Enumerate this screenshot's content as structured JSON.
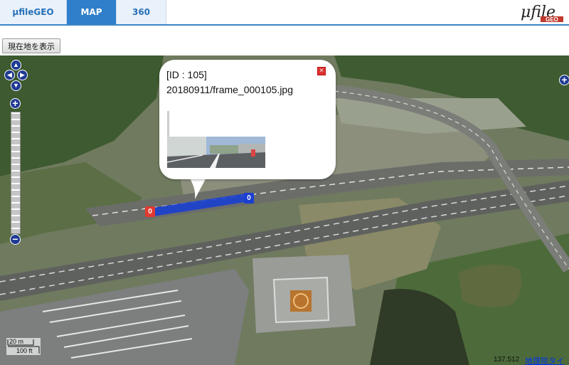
{
  "tabs": [
    {
      "label": "μfileGEO",
      "active": false
    },
    {
      "label": "MAP",
      "active": true
    },
    {
      "label": "360",
      "active": false
    }
  ],
  "logo": {
    "text": "μfile",
    "sub": "GEO"
  },
  "toolbar": {
    "current_location_label": "現在地を表示"
  },
  "controls": {
    "pan_up": "▲",
    "pan_left": "◀",
    "pan_right": "▶",
    "pan_down": "▼",
    "zoom_in": "+",
    "zoom_out": "−",
    "side_plus": "+"
  },
  "popup": {
    "id_text": "[ID : 105]",
    "file_text": "20180911/frame_000105.jpg",
    "close_label": "×"
  },
  "markers": [
    {
      "label": "0",
      "color": "#e03a2f"
    },
    {
      "label": "0",
      "color": "#1a3fd0"
    }
  ],
  "scale": {
    "meters": "20 m",
    "feet": "100 ft"
  },
  "footer": {
    "coords": "137.512",
    "link_text": "地理院タイル"
  },
  "colors": {
    "accent": "#2f7fca",
    "track": "#1a3fd0"
  }
}
